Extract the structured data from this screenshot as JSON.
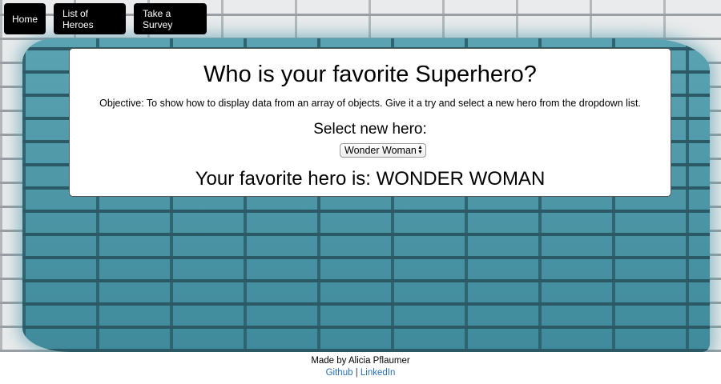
{
  "nav": {
    "home": "Home",
    "heroes": "List of Heroes",
    "survey": "Take a Survey"
  },
  "card": {
    "title": "Who is your favorite Superhero?",
    "objective": "Objective: To show how to display data from an array of objects. Give it a try and select a new hero from the dropdown list.",
    "select_label": "Select new hero:",
    "select_value": "Wonder Woman",
    "result_prefix": "Your favorite hero is:",
    "result_value": "WONDER WOMAN"
  },
  "footer": {
    "made_by": "Made by Alicia Pflaumer",
    "github": "Github",
    "separator": "|",
    "linkedin": "LinkedIn"
  },
  "colors": {
    "nav_bg": "#000000",
    "link": "#2a6fb0",
    "paint": "#4b97a8"
  }
}
